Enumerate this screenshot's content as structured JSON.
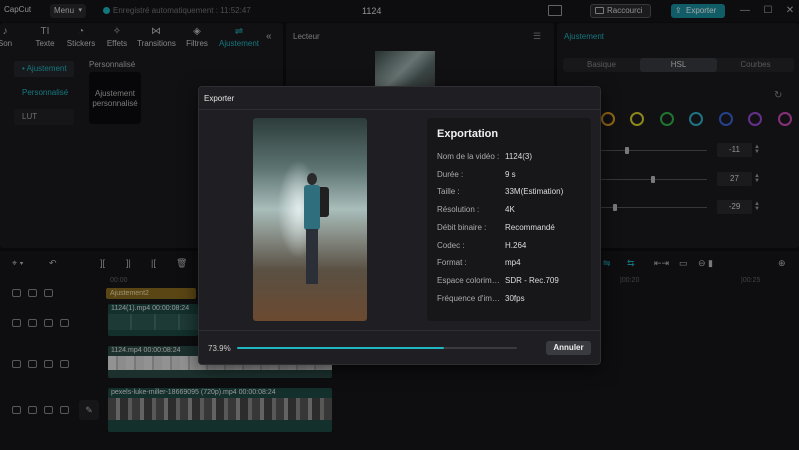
{
  "app": {
    "logo": "CapCut",
    "menu_label": "Menu",
    "autosave": "Enregistré automatiquement : 11:52:47",
    "project_title": "1124",
    "shortcuts_label": "Raccourci",
    "export_label": "Exporter",
    "window_controls": [
      "—",
      "☐",
      "✕"
    ]
  },
  "toolbar": {
    "items": [
      {
        "label": "Son",
        "icon": "music-icon"
      },
      {
        "label": "Texte",
        "icon": "text-icon"
      },
      {
        "label": "Stickers",
        "icon": "sticker-icon"
      },
      {
        "label": "Effets",
        "icon": "effects-icon"
      },
      {
        "label": "Transitions",
        "icon": "transition-icon"
      },
      {
        "label": "Filtres",
        "icon": "filter-icon"
      },
      {
        "label": "Ajustement",
        "icon": "adjust-icon"
      }
    ],
    "active": "Ajustement"
  },
  "left_nav": {
    "items": [
      "• Ajustement",
      "Personnalisé",
      "LUT"
    ],
    "section_title": "Personnalisé",
    "card_label": "Ajustement personnalisé"
  },
  "player": {
    "title": "Lecteur"
  },
  "adjust_panel": {
    "title": "Ajustement",
    "tabs": [
      "Basique",
      "HSL",
      "Courbes"
    ],
    "selected_tab": "HSL",
    "hue_colors": [
      "#e0533a",
      "#e0a01f",
      "#d8d02a",
      "#33b34a",
      "#2fb0c8",
      "#3a63d8",
      "#9a4ad8",
      "#d04ab8"
    ],
    "sliders": [
      {
        "value": "-11"
      },
      {
        "value": "27"
      },
      {
        "value": "-29"
      }
    ]
  },
  "timeline": {
    "ruler_ticks": [
      "00:00",
      "|00:20",
      "|00:25"
    ],
    "adjust_clip": "Ajustement2",
    "clips": [
      {
        "label": "1124(1).mp4   00:00:08:24"
      },
      {
        "label": "1124.mp4   00:00:08:24"
      },
      {
        "label": "pexels-luke-miller-18669095 (720p).mp4   00:00:08:24"
      }
    ]
  },
  "export_dialog": {
    "title": "Exporter",
    "info_title": "Exportation",
    "rows": [
      {
        "label": "Nom de la vidéo :",
        "value": "1124(3)"
      },
      {
        "label": "Durée :",
        "value": "9 s"
      },
      {
        "label": "Taille :",
        "value": "33M(Estimation)"
      },
      {
        "label": "Résolution :",
        "value": "4K"
      },
      {
        "label": "Débit binaire :",
        "value": "Recommandé"
      },
      {
        "label": "Codec :",
        "value": "H.264"
      },
      {
        "label": "Format :",
        "value": "mp4"
      },
      {
        "label": "Espace colorimétrique :",
        "value": "SDR - Rec.709"
      },
      {
        "label": "Fréquence d'images :",
        "value": "30fps"
      }
    ],
    "progress_text": "73.9%",
    "progress": 0.739,
    "cancel_label": "Annuler"
  },
  "colors": {
    "accent": "#1fb6c1",
    "export_button": "#1a8fa0",
    "adjust_clip": "#8a6a20"
  }
}
